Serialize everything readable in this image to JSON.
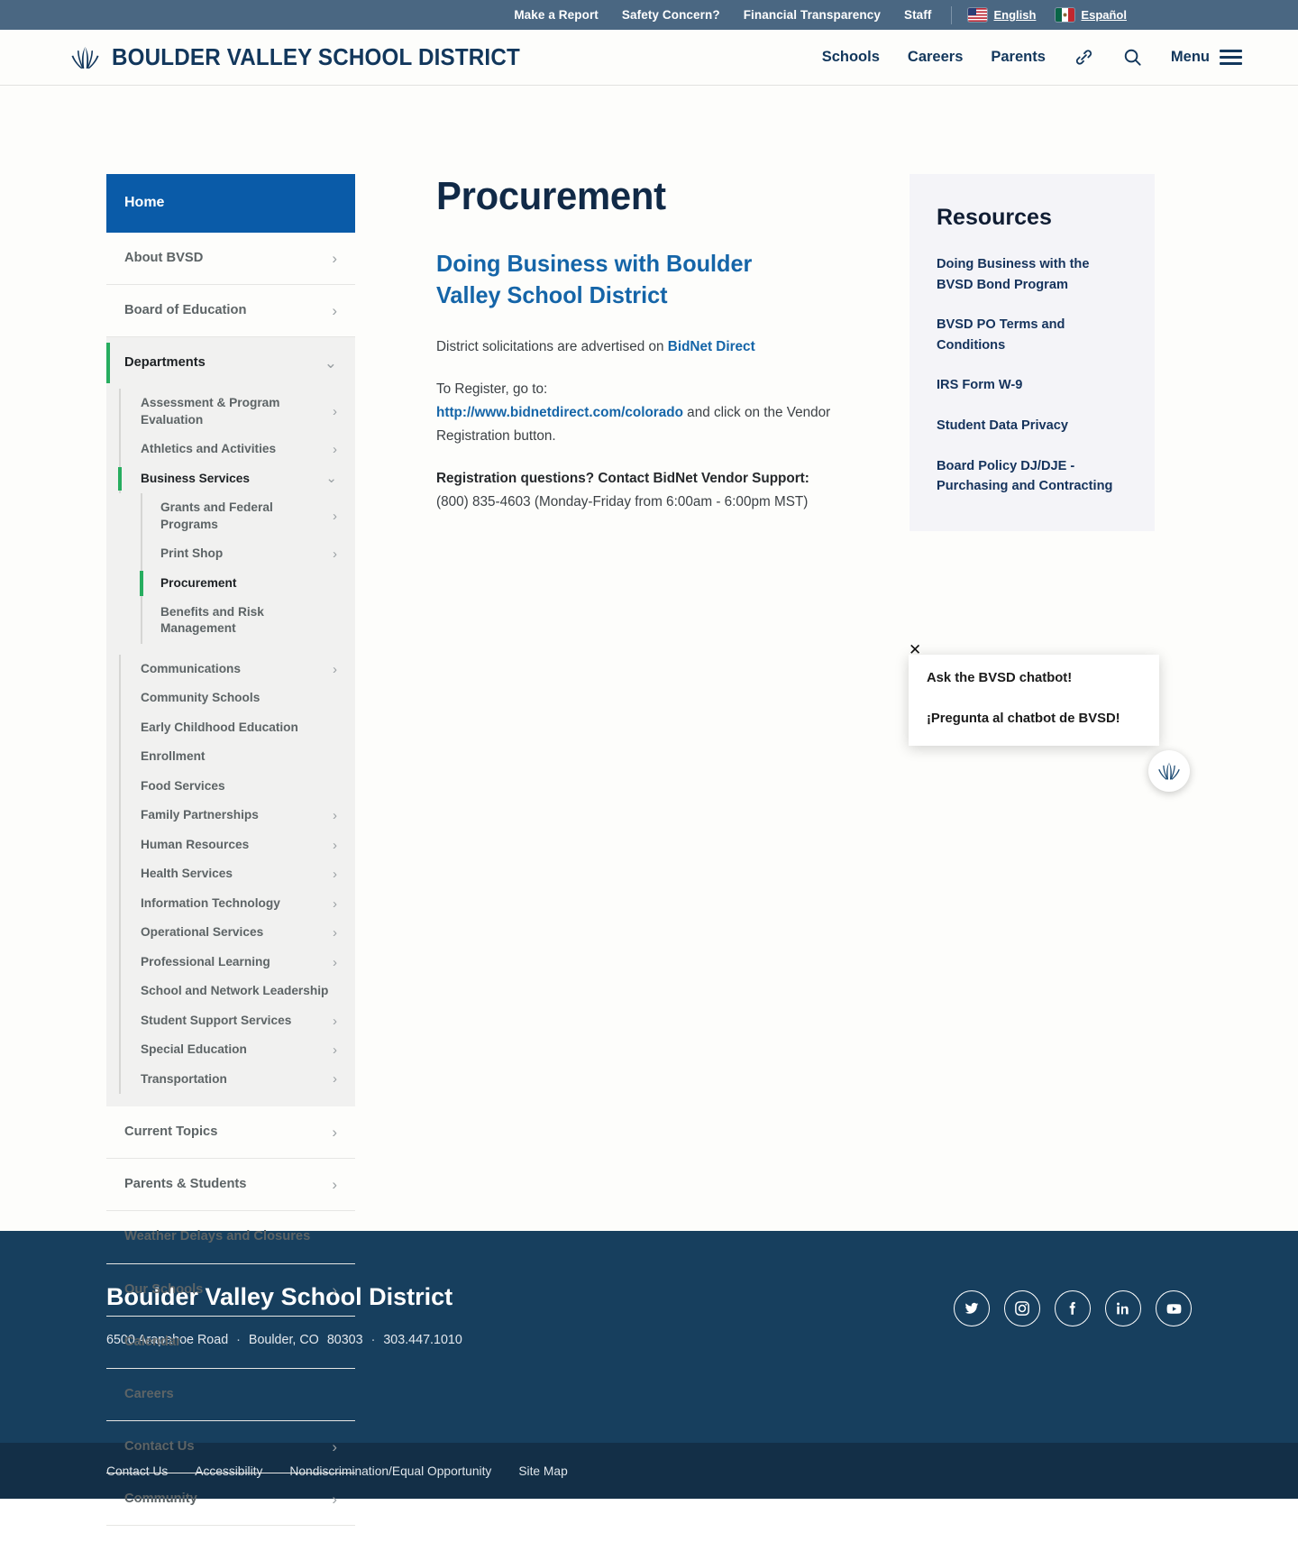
{
  "utility_bar": {
    "links": [
      {
        "label": "Make a Report"
      },
      {
        "label": "Safety Concern?"
      },
      {
        "label": "Financial Transparency"
      },
      {
        "label": "Staff"
      }
    ],
    "languages": [
      {
        "label": "English",
        "flag": "us-flag-icon"
      },
      {
        "label": "Español",
        "flag": "mexico-flag-icon"
      }
    ]
  },
  "header": {
    "brand": "BOULDER VALLEY SCHOOL DISTRICT",
    "nav": [
      {
        "label": "Schools"
      },
      {
        "label": "Careers"
      },
      {
        "label": "Parents"
      }
    ],
    "menu_label": "Menu"
  },
  "sidebar": {
    "home": "Home",
    "items": [
      {
        "label": "About BVSD",
        "chevron": "›"
      },
      {
        "label": "Board of Education",
        "chevron": "›"
      },
      {
        "label": "Departments",
        "chevron": "⌄"
      }
    ],
    "departments": [
      {
        "label": "Assessment & Program Evaluation",
        "chevron": "›"
      },
      {
        "label": "Athletics and Activities",
        "chevron": "›"
      },
      {
        "label": "Business Services",
        "chevron": "⌄"
      },
      {
        "label": "Communications",
        "chevron": "›"
      },
      {
        "label": "Community Schools",
        "chevron": ""
      },
      {
        "label": "Early Childhood Education",
        "chevron": ""
      },
      {
        "label": "Enrollment",
        "chevron": ""
      },
      {
        "label": "Food Services",
        "chevron": ""
      },
      {
        "label": "Family Partnerships",
        "chevron": "›"
      },
      {
        "label": "Human Resources",
        "chevron": "›"
      },
      {
        "label": "Health Services",
        "chevron": "›"
      },
      {
        "label": "Information Technology",
        "chevron": "›"
      },
      {
        "label": "Operational Services",
        "chevron": "›"
      },
      {
        "label": "Professional Learning",
        "chevron": "›"
      },
      {
        "label": "School and Network Leadership",
        "chevron": ""
      },
      {
        "label": "Student Support Services",
        "chevron": "›"
      },
      {
        "label": "Special Education",
        "chevron": "›"
      },
      {
        "label": "Transportation",
        "chevron": "›"
      }
    ],
    "business_services": [
      {
        "label": "Grants and Federal Programs",
        "chevron": "›"
      },
      {
        "label": "Print Shop",
        "chevron": "›"
      },
      {
        "label": "Procurement",
        "chevron": ""
      },
      {
        "label": "Benefits and Risk Management",
        "chevron": ""
      }
    ],
    "bottom_items": [
      {
        "label": "Current Topics",
        "chevron": "›"
      },
      {
        "label": "Parents & Students",
        "chevron": "›"
      },
      {
        "label": "Weather Delays and Closures",
        "chevron": ""
      },
      {
        "label": "Our Schools",
        "chevron": "›"
      },
      {
        "label": "Calendar",
        "chevron": ""
      },
      {
        "label": "Careers",
        "chevron": ""
      },
      {
        "label": "Contact Us",
        "chevron": "›"
      },
      {
        "label": "Community",
        "chevron": "›"
      }
    ]
  },
  "main": {
    "title": "Procurement",
    "subhead": "Doing Business with Boulder Valley School District",
    "p1_before": "District solicitations are advertised on ",
    "p1_link": "BidNet Direct",
    "p2_line1": "To Register, go to:",
    "p2_link": "http://www.bidnetdirect.com/colorado",
    "p2_after": " and click on the Vendor Registration button.",
    "p3_bold": "Registration questions? Contact BidNet Vendor Support:",
    "p3_normal": "  (800) 835-4603 (Monday-Friday from 6:00am - 6:00pm MST)"
  },
  "resources": {
    "title": "Resources",
    "links": [
      {
        "label": "Doing Business with the BVSD Bond Program"
      },
      {
        "label": "BVSD PO Terms and Conditions"
      },
      {
        "label": "IRS Form W-9"
      },
      {
        "label": "Student Data Privacy"
      },
      {
        "label": "Board Policy DJ/DJE - Purchasing and Contracting"
      }
    ]
  },
  "chatbot": {
    "close": "✕",
    "line_en": "Ask the BVSD chatbot!",
    "line_es": "¡Pregunta al chatbot de BVSD!"
  },
  "footer": {
    "title": "Boulder Valley School District",
    "street": "6500 Arapahoe Road",
    "city": "Boulder, CO",
    "zip": "80303",
    "phone": "303.447.1010",
    "separator": "·",
    "social": [
      {
        "name": "twitter-icon"
      },
      {
        "name": "instagram-icon"
      },
      {
        "name": "facebook-icon"
      },
      {
        "name": "linkedin-icon"
      },
      {
        "name": "youtube-icon"
      }
    ],
    "bottom_links": [
      {
        "label": "Contact Us"
      },
      {
        "label": "Accessibility"
      },
      {
        "label": "Nondiscrimination/Equal Opportunity"
      },
      {
        "label": "Site Map"
      }
    ]
  },
  "colors": {
    "utility_bar": "#4a6782",
    "brand_navy": "#12375c",
    "home_blue": "#0a5ba8",
    "accent_green": "#27ad5f",
    "link_blue": "#1565a8",
    "footer_navy": "#173f5e",
    "footer_bottom": "#132f47",
    "resources_bg": "#f4f4f8"
  }
}
